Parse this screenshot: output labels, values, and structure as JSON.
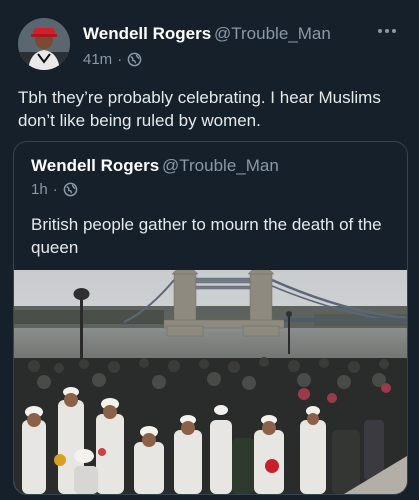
{
  "tweet": {
    "author_name": "Wendell Rogers",
    "author_handle": "@Trouble_Man",
    "time": "41m",
    "visibility_icon": "globe-icon",
    "text": "Tbh they’re probably celebrating. I hear Muslims don’t like being ruled by women."
  },
  "quoted_tweet": {
    "author_name": "Wendell Rogers",
    "author_handle": "@Trouble_Man",
    "time": "1h",
    "visibility_icon": "globe-icon",
    "text": "British people gather to mourn the death of the queen"
  },
  "colors": {
    "background": "#15202b",
    "primary_text": "#e7e9ea",
    "secondary_text": "#8b98a5",
    "border": "#38444d"
  }
}
